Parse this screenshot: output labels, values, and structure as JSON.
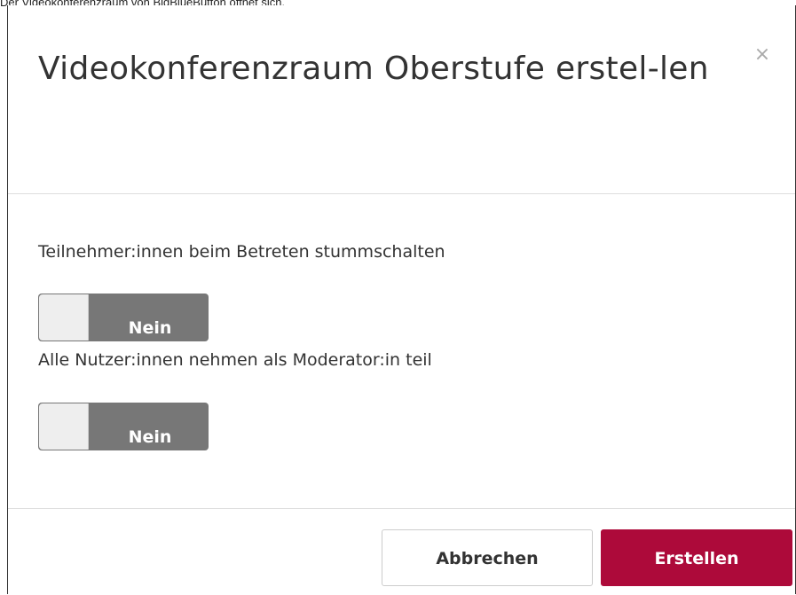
{
  "caption": "Der Videokonferenzraum von BigBlueButton öffnet sich.",
  "modal": {
    "title": "Videokonferenzraum Oberstufe erstel-len",
    "close_label": "×"
  },
  "settings": [
    {
      "label": "Teilnehmer:innen beim Betreten stummschalten",
      "toggle_value": "Nein"
    },
    {
      "label": "Alle Nutzer:innen nehmen als Moderator:in teil",
      "toggle_value": "Nein"
    }
  ],
  "footer": {
    "cancel_label": "Abbrechen",
    "create_label": "Erstellen"
  },
  "colors": {
    "primary": "#ad0a3a",
    "toggle_off": "#777777"
  }
}
